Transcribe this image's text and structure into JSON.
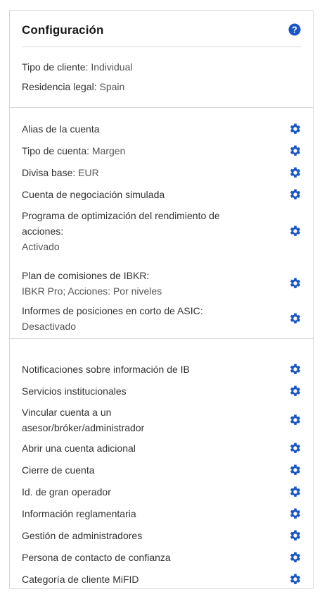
{
  "header": {
    "title": "Configuración"
  },
  "profile": {
    "client_type_label": "Tipo de cliente:",
    "client_type_value": "Individual",
    "legal_residence_label": "Residencia legal:",
    "legal_residence_value": "Spain"
  },
  "account_settings": {
    "alias": {
      "label": "Alias de la cuenta"
    },
    "account_type": {
      "label": "Tipo de cuenta:",
      "value": "Margen"
    },
    "base_currency": {
      "label": "Divisa base:",
      "value": "EUR"
    },
    "paper_trading": {
      "label": "Cuenta de negociación simulada"
    },
    "stock_yield": {
      "label_line1": "Programa de optimización del rendimiento de",
      "label_line2": "acciones:",
      "value": "Activado"
    },
    "commission_plan": {
      "label": "Plan de comisiones de IBKR:",
      "value": "IBKR Pro; Acciones: Por niveles"
    },
    "asic_short": {
      "label": "Informes de posiciones en corto de ASIC:",
      "value": "Desactivado"
    }
  },
  "other_settings": {
    "items": [
      "Notificaciones sobre información de IB",
      "Servicios institucionales",
      "Vincular cuenta a un",
      "asesor/bróker/administrador",
      "Abrir una cuenta adicional",
      "Cierre de cuenta",
      "Id. de gran operador",
      "Información reglamentaria",
      "Gestión de administradores",
      "Persona de contacto de confianza",
      "Categoría de cliente MiFID"
    ]
  },
  "colors": {
    "accent": "#1a56c4",
    "border": "#d6d6d6",
    "text": "#333333"
  },
  "icons": {
    "help": "help-circle-icon",
    "settings": "gear-icon"
  }
}
